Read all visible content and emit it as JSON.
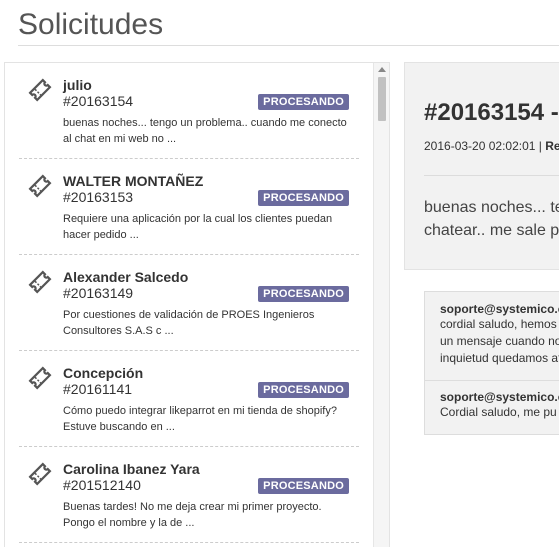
{
  "page": {
    "title": "Solicitudes"
  },
  "tickets": [
    {
      "name": "julio",
      "id": "#20163154",
      "status": "PROCESANDO",
      "excerpt": "buenas noches... tengo un problema.. cuando me conecto al chat en mi web no ..."
    },
    {
      "name": "WALTER MONTAÑEZ",
      "id": "#20163153",
      "status": "PROCESANDO",
      "excerpt": "Requiere una aplicación por la cual los clientes puedan hacer pedido ..."
    },
    {
      "name": "Alexander Salcedo",
      "id": "#20163149",
      "status": "PROCESANDO",
      "excerpt": "Por cuestiones de validación de PROES Ingenieros Consultores S.A.S c ..."
    },
    {
      "name": "Concepción",
      "id": "#20161141",
      "status": "PROCESANDO",
      "excerpt": "Cómo puedo integrar likeparrot en mi tienda de shopify? Estuve buscando en ..."
    },
    {
      "name": "Carolina Ibanez Yara",
      "id": "#201512140",
      "status": "PROCESANDO",
      "excerpt": "Buenas tardes! No me deja crear mi primer proyecto. Pongo el nombre y la de ..."
    }
  ],
  "detail": {
    "title": "#20163154 -",
    "date": "2016-03-20 02:02:01",
    "separator": "|",
    "meta_label": "Re",
    "body_line1": "buenas noches... te",
    "body_line2": "chatear.. me sale p"
  },
  "comments": [
    {
      "author": "soporte@systemico.c",
      "lines": [
        "cordial saludo, hemos",
        "un mensaje cuando no",
        "inquietud quedamos at"
      ]
    },
    {
      "author": "soporte@systemico.c",
      "lines": [
        "Cordial saludo, me pu"
      ]
    }
  ],
  "colors": {
    "badge": "#6b6b9e",
    "panel_bg": "#f2f2f2"
  }
}
